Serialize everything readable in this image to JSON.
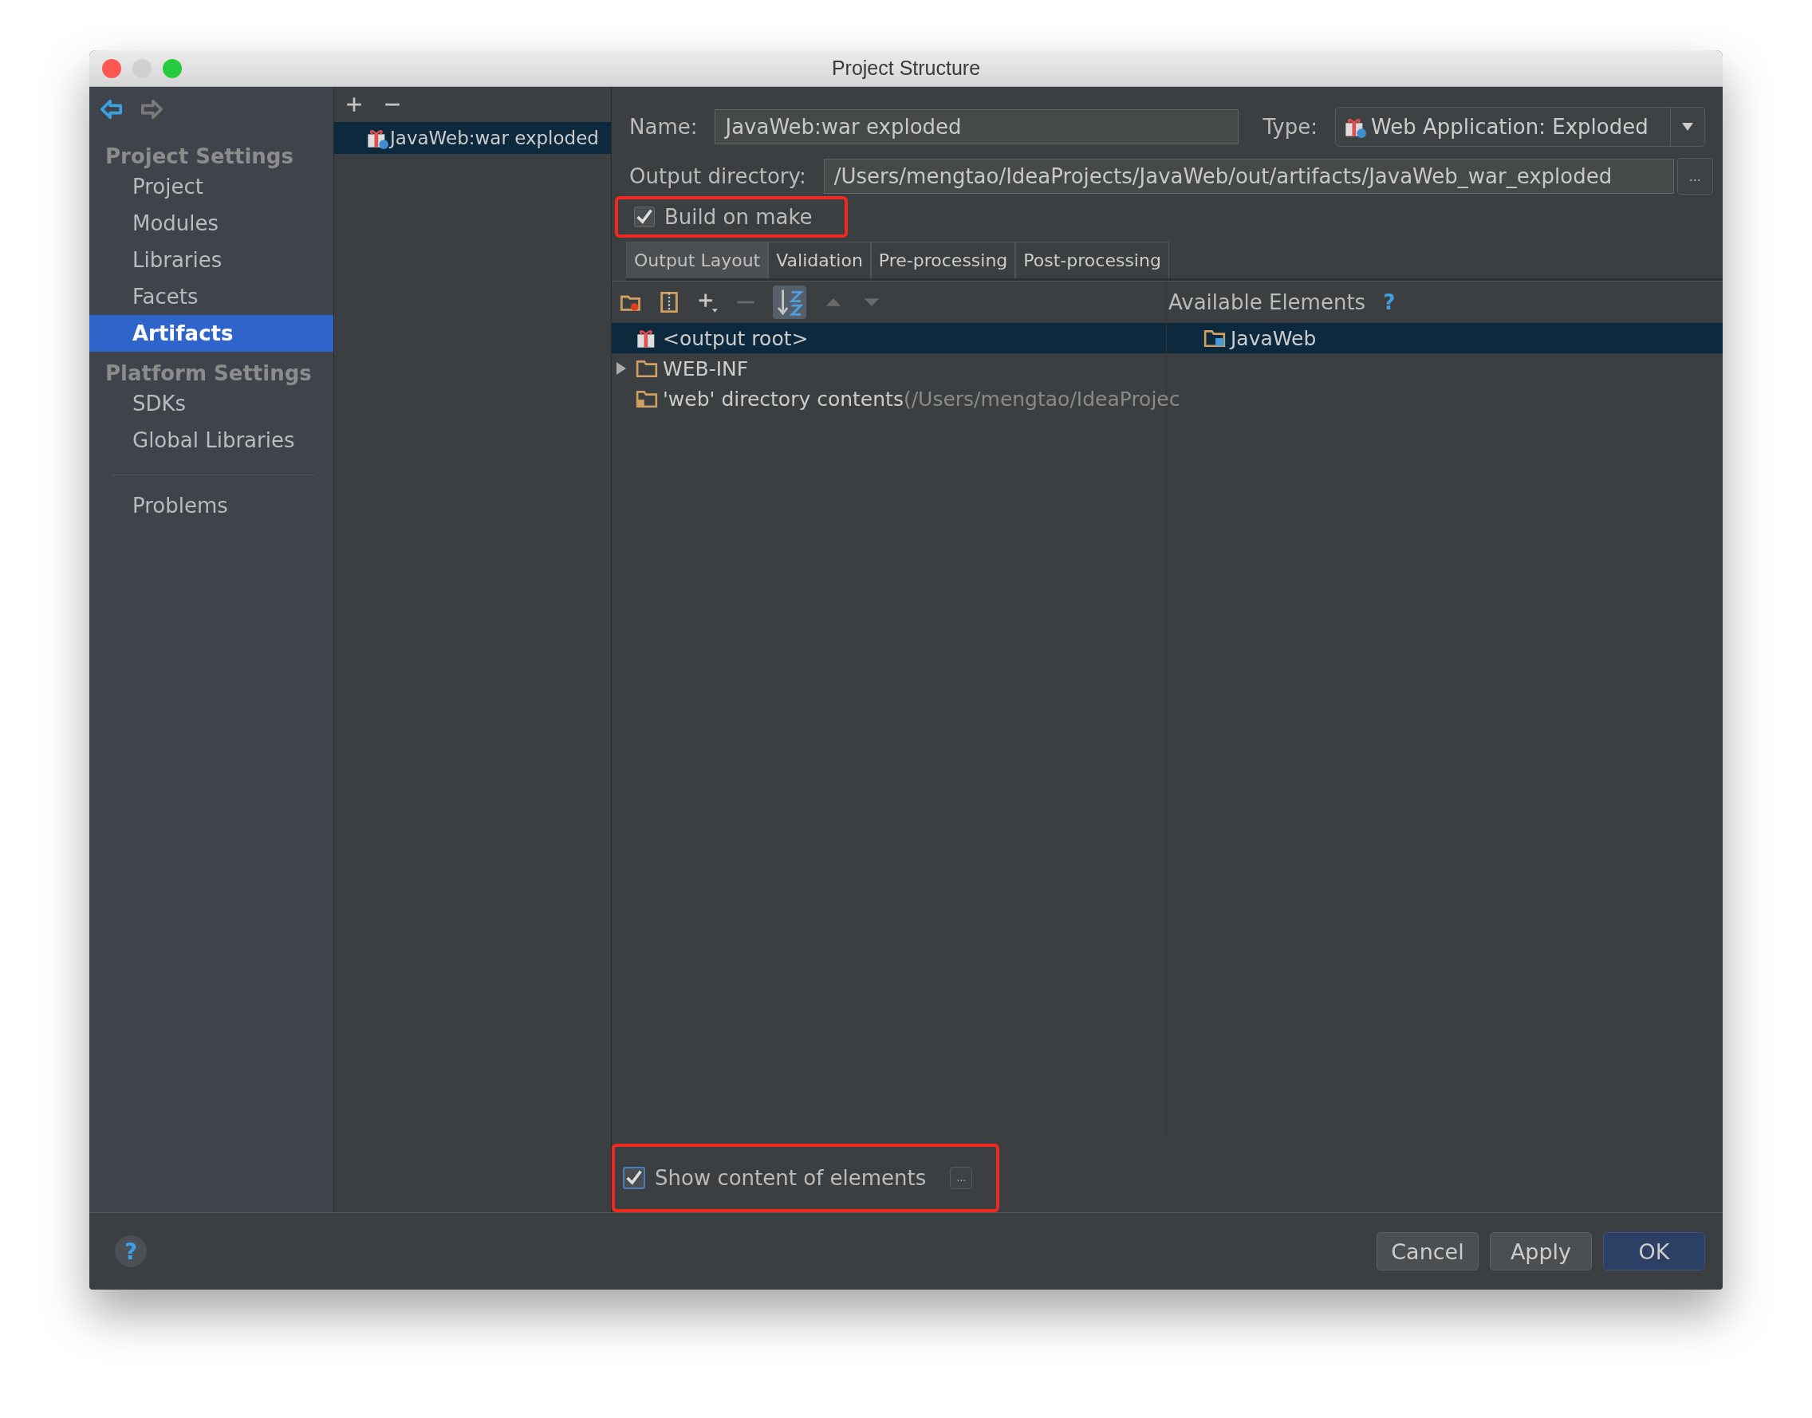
{
  "window": {
    "title": "Project Structure"
  },
  "sidebar": {
    "sections": [
      {
        "heading": "Project Settings",
        "items": [
          {
            "label": "Project",
            "selected": false
          },
          {
            "label": "Modules",
            "selected": false
          },
          {
            "label": "Libraries",
            "selected": false
          },
          {
            "label": "Facets",
            "selected": false
          },
          {
            "label": "Artifacts",
            "selected": true
          }
        ]
      },
      {
        "heading": "Platform Settings",
        "items": [
          {
            "label": "SDKs",
            "selected": false
          },
          {
            "label": "Global Libraries",
            "selected": false
          }
        ]
      }
    ],
    "problems": "Problems"
  },
  "artifacts": [
    {
      "label": "JavaWeb:war exploded",
      "selected": true
    }
  ],
  "form": {
    "name_label": "Name:",
    "name": "JavaWeb:war exploded",
    "type_label": "Type:",
    "type": "Web Application: Exploded",
    "output_label": "Output directory:",
    "output": "/Users/mengtao/IdeaProjects/JavaWeb/out/artifacts/JavaWeb_war_exploded",
    "browse": "...",
    "build_on_make": {
      "label": "Build on make",
      "checked": true,
      "highlighted": true
    }
  },
  "tabs": [
    {
      "label": "Output Layout",
      "selected": true
    },
    {
      "label": "Validation",
      "selected": false
    },
    {
      "label": "Pre-processing",
      "selected": false
    },
    {
      "label": "Post-processing",
      "selected": false
    }
  ],
  "layout_tree": [
    {
      "kind": "artifact",
      "label": "<output root>",
      "selected": true
    },
    {
      "kind": "folder",
      "label": "WEB-INF",
      "selected": false,
      "expanded": false
    },
    {
      "kind": "directory",
      "label": "'web' directory contents",
      "detail": "(/Users/mengtao/IdeaProjec",
      "selected": false
    }
  ],
  "available": {
    "heading": "Available Elements",
    "help": "?",
    "items": [
      {
        "label": "JavaWeb",
        "selected": true
      }
    ]
  },
  "show_content": {
    "label": "Show content of elements",
    "checked": true,
    "highlighted": true,
    "more": "..."
  },
  "footer": {
    "help": "?",
    "buttons": [
      {
        "label": "Cancel",
        "default": false
      },
      {
        "label": "Apply",
        "default": false
      },
      {
        "label": "OK",
        "default": true
      }
    ]
  }
}
